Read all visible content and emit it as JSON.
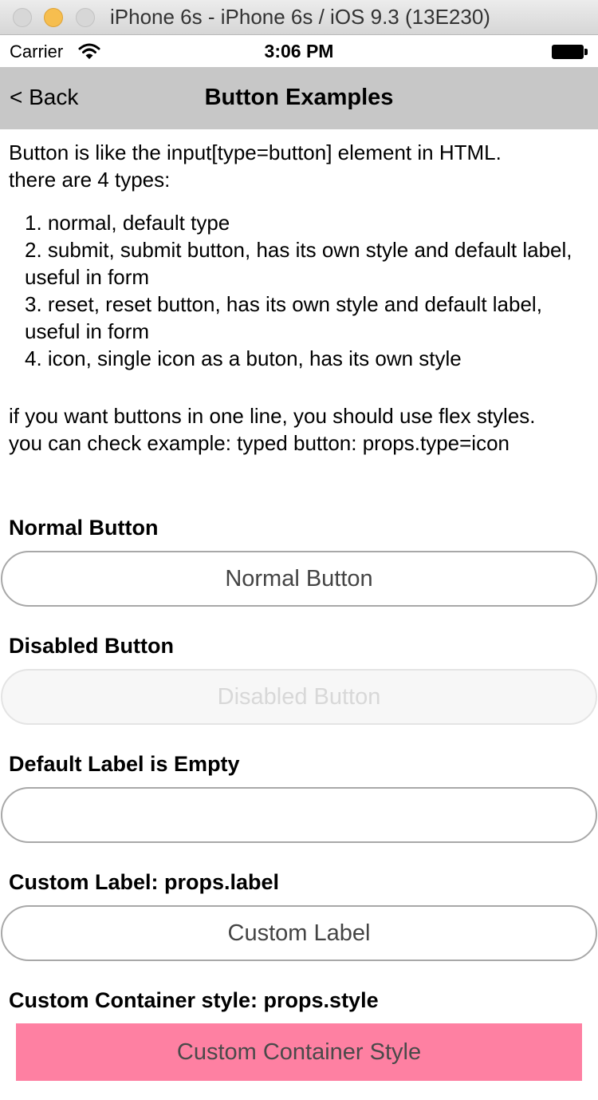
{
  "window": {
    "title": "iPhone 6s - iPhone 6s / iOS 9.3 (13E230)"
  },
  "status_bar": {
    "carrier": "Carrier",
    "time": "3:06 PM"
  },
  "nav": {
    "back_label": "< Back",
    "title": "Button Examples"
  },
  "intro": {
    "line1": "Button is like the input[type=button] element in HTML.",
    "line2": "there are 4 types:"
  },
  "types": [
    "1. normal, default type",
    "2. submit, submit button, has its own style and default label, useful in form",
    "3. reset, reset button, has its own style and default label, useful in form",
    "4. icon, single icon as a buton, has its own style"
  ],
  "note": {
    "line1": "if you want buttons in one line, you should use flex styles.",
    "line2": "you can check example: typed button: props.type=icon"
  },
  "sections": {
    "normal": {
      "title": "Normal Button",
      "button_label": "Normal Button"
    },
    "disabled": {
      "title": "Disabled Button",
      "button_label": "Disabled Button"
    },
    "empty": {
      "title": "Default Label is Empty",
      "button_label": ""
    },
    "custom_label": {
      "title": "Custom Label: props.label",
      "button_label": "Custom Label"
    },
    "custom_style": {
      "title": "Custom Container style: props.style",
      "button_label": "Custom Container Style"
    }
  },
  "colors": {
    "nav_background": "#c7c7c7",
    "custom_container_background": "#fe80a2",
    "button_border": "#a8a8a8"
  }
}
